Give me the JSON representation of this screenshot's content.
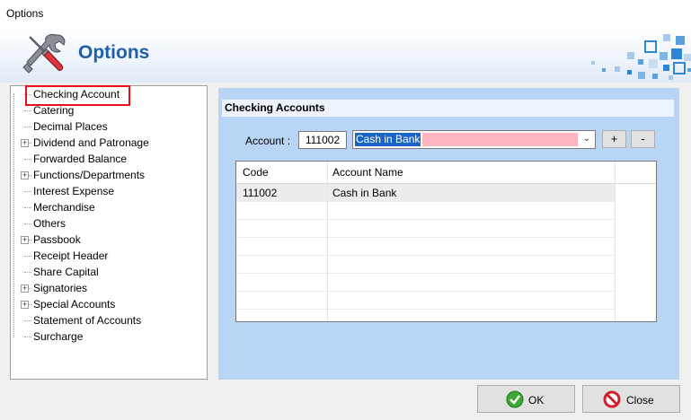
{
  "window": {
    "title": "Options"
  },
  "banner": {
    "heading": "Options"
  },
  "tree": {
    "items": [
      {
        "label": "Checking Account",
        "expandable": false
      },
      {
        "label": "Catering",
        "expandable": false
      },
      {
        "label": "Decimal Places",
        "expandable": false
      },
      {
        "label": "Dividend and Patronage",
        "expandable": true
      },
      {
        "label": "Forwarded Balance",
        "expandable": false
      },
      {
        "label": "Functions/Departments",
        "expandable": true
      },
      {
        "label": "Interest Expense",
        "expandable": false
      },
      {
        "label": "Merchandise",
        "expandable": false
      },
      {
        "label": "Others",
        "expandable": false
      },
      {
        "label": "Passbook",
        "expandable": true
      },
      {
        "label": "Receipt Header",
        "expandable": false
      },
      {
        "label": "Share Capital",
        "expandable": false
      },
      {
        "label": "Signatories",
        "expandable": true
      },
      {
        "label": "Special Accounts",
        "expandable": true
      },
      {
        "label": "Statement of Accounts",
        "expandable": false
      },
      {
        "label": "Surcharge",
        "expandable": false
      }
    ],
    "selected": "Checking Account"
  },
  "panel": {
    "header": "Checking Accounts",
    "account_label": "Account :",
    "account_code": "111002",
    "account_name": "Cash in Bank",
    "add_label": "+",
    "remove_label": "-"
  },
  "grid": {
    "columns": [
      "Code",
      "Account Name"
    ],
    "rows": [
      {
        "code": "111002",
        "name": "Cash in Bank"
      }
    ]
  },
  "footer": {
    "ok_label": "OK",
    "close_label": "Close"
  },
  "colors": {
    "accent": "#1f5fa8",
    "panel": "#b8d5f6",
    "highlight": "#e8101c",
    "pink": "#ffb6c1"
  }
}
